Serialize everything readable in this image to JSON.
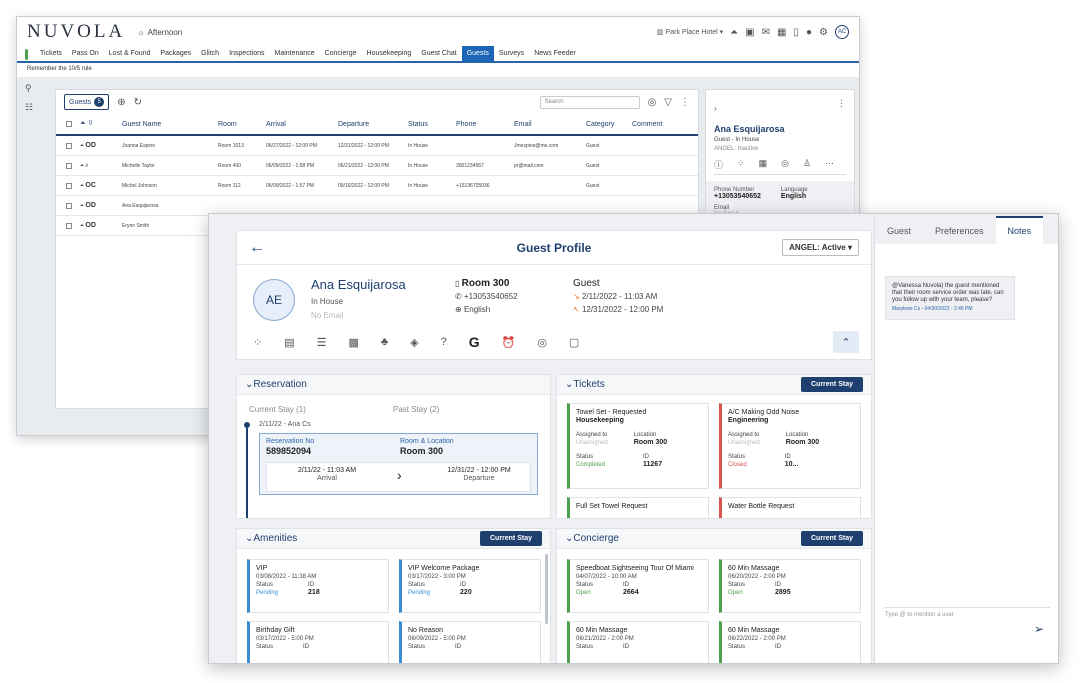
{
  "back": {
    "logo": "NUVOLA",
    "greeting": "Afternoon",
    "hotel": "Park Place Hotel",
    "avatar": "AC",
    "nav": [
      "Tickets",
      "Pass On",
      "Lost & Found",
      "Packages",
      "Glitch",
      "Inspections",
      "Maintenance",
      "Concierge",
      "Housekeeping",
      "Guest Chat",
      "Guests",
      "Surveys",
      "News Feeder"
    ],
    "note": "Remember the 10/5 rule",
    "guests_label": "Guests",
    "guests_count": "5",
    "search_placeholder": "Search",
    "columns": [
      "Guest Name",
      "Room",
      "Arrival",
      "Departure",
      "Status",
      "Phone",
      "Email",
      "Category",
      "Comment"
    ],
    "rows": [
      {
        "code": "OD",
        "name": "Joanna Espino",
        "room": "Room 1013",
        "arrival": "06/27/2022 - 12:00 PM",
        "departure": "12/31/2022 - 12:00 PM",
        "status": "In House",
        "phone": "",
        "email": "Jmespino@me.com",
        "category": "Guest"
      },
      {
        "code": "",
        "name": "Michelle Taylor",
        "room": "Room 400",
        "arrival": "06/09/2022 - 1:58 PM",
        "departure": "06/21/2022 - 12:00 PM",
        "status": "In House",
        "phone": "3001234567",
        "email": "pr@mail.com",
        "category": "Guest"
      },
      {
        "code": "OC",
        "name": "Michel Johnson",
        "room": "Room 112",
        "arrival": "06/09/2022 - 1:57 PM",
        "departure": "09/16/2022 - 12:00 PM",
        "status": "In House",
        "phone": "+15136705036",
        "email": "",
        "category": "Guest"
      },
      {
        "code": "OD",
        "name": "Ana Esquijarosa",
        "room": "",
        "arrival": "",
        "departure": "",
        "status": "",
        "phone": "",
        "email": "",
        "category": ""
      },
      {
        "code": "OD",
        "name": "Erynn Smith",
        "room": "",
        "arrival": "",
        "departure": "",
        "status": "",
        "phone": "",
        "email": "",
        "category": ""
      }
    ],
    "right": {
      "name": "Ana Esquijarosa",
      "sub": "Guest - In House",
      "angel": "ANGEL: Inactive",
      "phone_label": "Phone Number",
      "phone": "+13053540652",
      "lang_label": "Language",
      "lang": "English",
      "email_label": "Email",
      "email": "No Email"
    }
  },
  "front": {
    "title": "Guest Profile",
    "angel": "ANGEL: Active",
    "initials": "AE",
    "name": "Ana Esquijarosa",
    "status": "In House",
    "email": "No Email",
    "room": "Room 300",
    "phone": "+13053540652",
    "language": "English",
    "type": "Guest",
    "arrival": "2/11/2022 - 11:03 AM",
    "departure": "12/31/2022 - 12:00 PM",
    "reservation": {
      "title": "Reservation",
      "current": "Current Stay (1)",
      "past": "Past Stay (2)",
      "date": "2/11/22 - Ana Cs",
      "no_label": "Reservation No",
      "no": "589852094",
      "loc_label": "Room & Location",
      "loc": "Room 300",
      "arr": "2/11/22 - 11:03 AM",
      "arr_label": "Arrival",
      "dep": "12/31/22 - 12:00 PM",
      "dep_label": "Departure"
    },
    "tickets": {
      "title": "Tickets",
      "btn": "Current Stay",
      "items": [
        {
          "title": "Towel Set - Requested",
          "dept": "Housekeeping",
          "assigned": "Unassigned",
          "location": "Room 300",
          "status": "Completed",
          "id": "11267"
        },
        {
          "title": "A/C Making Odd Noise",
          "dept": "Engineering",
          "assigned": "Unassigned",
          "location": "Room 300",
          "status": "Closed",
          "id": "10..."
        }
      ],
      "more": [
        "Full Set Towel Request",
        "Water Bottle Request"
      ],
      "labels": {
        "assigned": "Assigned to",
        "location": "Location",
        "status": "Status",
        "id": "ID"
      }
    },
    "amenities": {
      "title": "Amenities",
      "btn": "Current Stay",
      "items": [
        {
          "title": "VIP",
          "date": "03/08/2022 - 11:38 AM",
          "status": "Pending",
          "id": "218"
        },
        {
          "title": "VIP Welcome Package",
          "date": "03/17/2022 - 3:00 PM",
          "status": "Pending",
          "id": "220"
        },
        {
          "title": "Birthday Gift",
          "date": "03/17/2022 - 5:00 PM"
        },
        {
          "title": "No Reason",
          "date": "06/09/2022 - 5:00 PM"
        }
      ]
    },
    "concierge": {
      "title": "Concierge",
      "btn": "Current Stay",
      "items": [
        {
          "title": "Speedboat Sightseeing Tour Of Miami",
          "date": "04/07/2022 - 10:00 AM",
          "status": "Open",
          "id": "2664"
        },
        {
          "title": "60 Min Massage",
          "date": "06/20/2022 - 2:00 PM",
          "status": "Open",
          "id": "2895"
        },
        {
          "title": "60 Min Massage",
          "date": "06/21/2022 - 2:00 PM"
        },
        {
          "title": "60 Min Massage",
          "date": "06/22/2022 - 2:00 PM"
        }
      ]
    },
    "side": {
      "tabs": [
        "Guest",
        "Preferences",
        "Notes"
      ],
      "note": "@Vanessa Nuvola) the guest mentioned that their room service order was late, can you follow up with your team, please?",
      "note_meta": "Marylean Cs - 04/30/2022 - 2:45 PM",
      "mention_placeholder": "Type @ to mention a user"
    }
  },
  "colors": {
    "primary": "#1f3f6e",
    "accent": "#1e64b7",
    "green": "#4ea24e",
    "red": "#d9534f"
  }
}
